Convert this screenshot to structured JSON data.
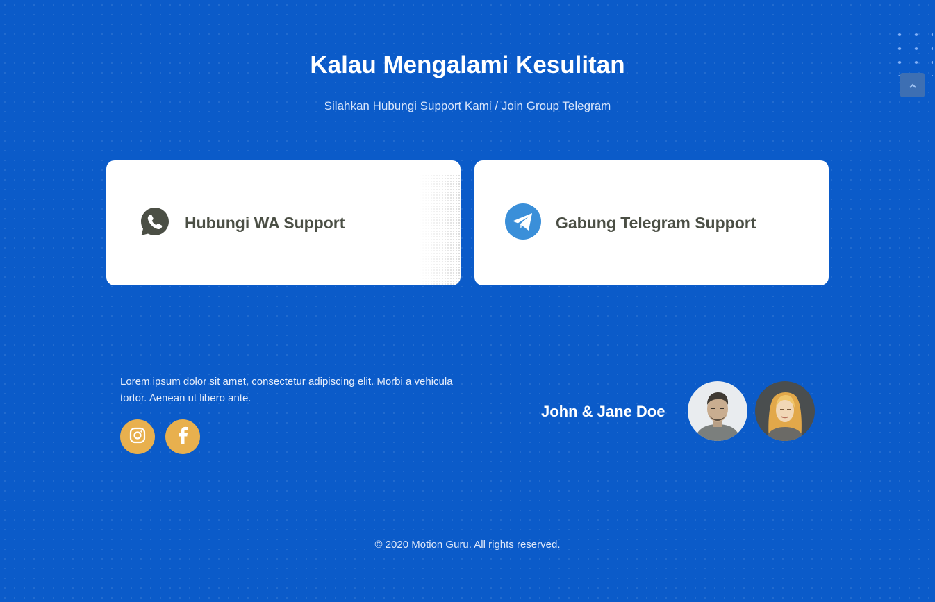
{
  "header": {
    "title": "Kalau Mengalami Kesulitan",
    "subtitle": "Silahkan Hubungi Support Kami / Join Group Telegram"
  },
  "cards": [
    {
      "label": "Hubungi WA Support",
      "icon": "whatsapp-icon"
    },
    {
      "label": "Gabung Telegram Support",
      "icon": "telegram-icon"
    }
  ],
  "footer": {
    "description": "Lorem ipsum dolor sit amet, consectetur adipiscing elit. Morbi a vehicula tortor. Aenean ut libero ante.",
    "social": [
      "instagram-icon",
      "facebook-icon"
    ],
    "couple_name": "John & Jane Doe",
    "copyright": "© 2020 Motion Guru. All rights reserved."
  },
  "colors": {
    "background": "#0b5bc9",
    "card": "#ffffff",
    "card_text": "#4b4f45",
    "social_button": "#e8b04e",
    "telegram": "#3a8fd9"
  }
}
